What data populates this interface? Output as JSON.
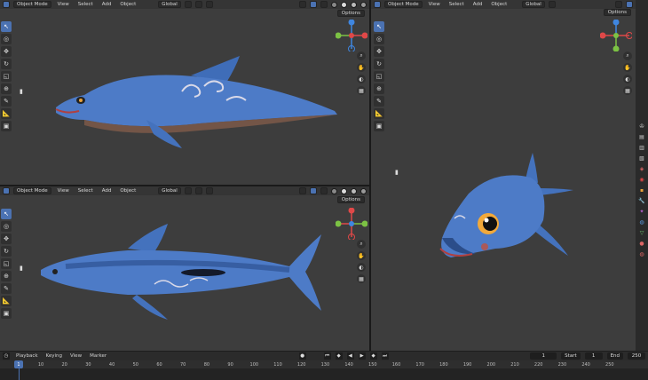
{
  "viewport_header": {
    "mode": "Object Mode",
    "view": "View",
    "select": "Select",
    "add": "Add",
    "object": "Object",
    "transform": "Global"
  },
  "options_label": "Options",
  "gizmo_labels": {
    "x": "X",
    "y": "Y",
    "z": "Z"
  },
  "timeline": {
    "playback": "Playback",
    "keying": "Keying",
    "view": "View",
    "marker": "Marker",
    "current_frame": "1",
    "start_label": "Start",
    "start_value": "1",
    "end_label": "End",
    "end_value": "250",
    "ruler_current": "1",
    "ruler_ticks": [
      "10",
      "20",
      "30",
      "40",
      "50",
      "60",
      "70",
      "80",
      "90",
      "100",
      "110",
      "120",
      "130",
      "140",
      "150",
      "160",
      "170",
      "180",
      "190",
      "200",
      "210",
      "220",
      "230",
      "240",
      "250"
    ]
  },
  "colors": {
    "accent": "#4b72b2",
    "viewport_bg": "#3d3d3d",
    "dolphin_body": "#4d7bc7",
    "dolphin_dark": "#27487f",
    "axis_x": "#e04848",
    "axis_y": "#7cc244",
    "axis_z": "#3f86e0"
  }
}
